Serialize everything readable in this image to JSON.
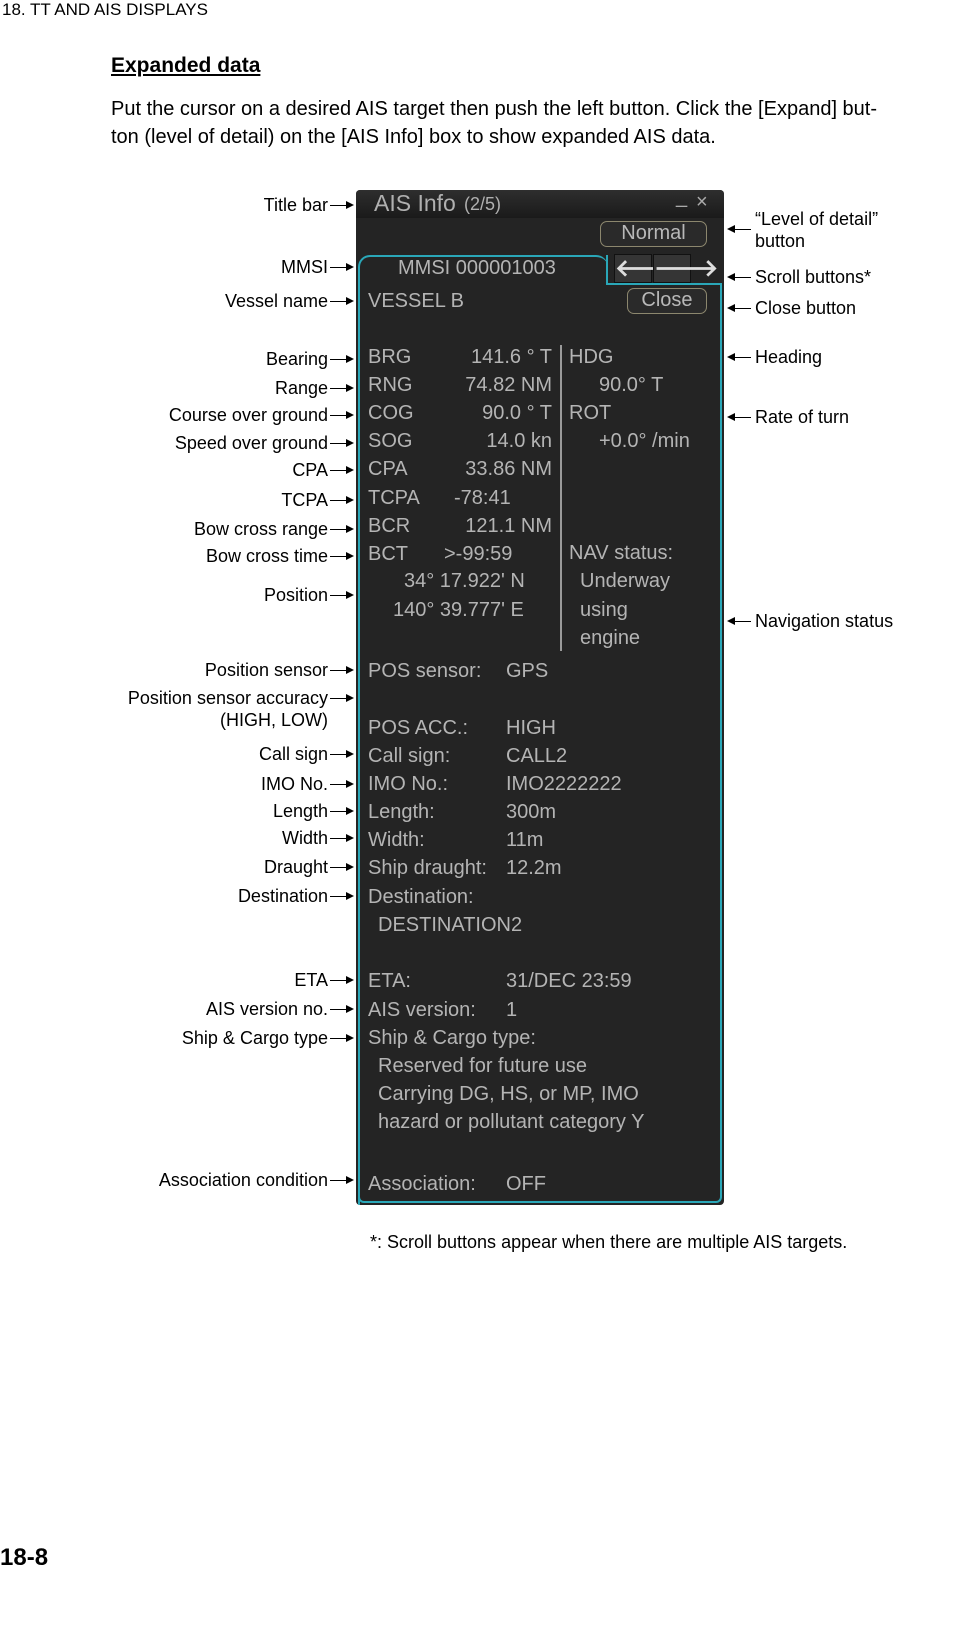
{
  "header": "18.  TT AND AIS DISPLAYS",
  "section_title": "Expanded data",
  "intro": [
    "Put the cursor on a desired AIS target then push the left button. Click the [Expand] but-",
    "ton (level of detail) on the [AIS Info] box to show expanded AIS data."
  ],
  "footnote": "*: Scroll buttons appear when there are multiple AIS targets.",
  "page_number": "18-8",
  "panel": {
    "title": "AIS Info",
    "count": "(2/5)",
    "minimize": "_",
    "close_x": "×",
    "level_button": "Normal",
    "close_button": "Close",
    "scroll_left": "🡐",
    "scroll_right": "🡒",
    "mmsi": "MMSI 000001003",
    "vessel": "VESSEL B",
    "left_rows": [
      [
        "BRG",
        "141.6 ° T"
      ],
      [
        "RNG",
        "74.82 NM"
      ],
      [
        "COG",
        "90.0 ° T"
      ],
      [
        "SOG",
        "14.0 kn"
      ],
      [
        "CPA",
        "33.86 NM"
      ],
      [
        "TCPA",
        "-78:41"
      ],
      [
        "BCR",
        "121.1 NM"
      ],
      [
        "BCT",
        ">-99:59"
      ]
    ],
    "lat": "34° 17.922'  N",
    "lon": "140° 39.777'  E",
    "hdg_label": "HDG",
    "hdg": "90.0° T",
    "rot_label": "ROT",
    "rot": "+0.0° /min",
    "nav_label": "NAV status:",
    "nav_lines": [
      "Underway",
      "using",
      "engine"
    ],
    "details": [
      [
        "POS sensor:",
        "GPS"
      ],
      [
        "POS ACC.:",
        "HIGH"
      ],
      [
        "Call sign:",
        "CALL2"
      ],
      [
        "IMO No.:",
        "IMO2222222"
      ],
      [
        "Length:",
        "300m"
      ],
      [
        "Width:",
        "11m"
      ],
      [
        "Ship draught:",
        "12.2m"
      ],
      [
        "Destination:",
        ""
      ],
      [
        "",
        "DESTINATION2"
      ],
      [
        "ETA:",
        "31/DEC 23:59"
      ],
      [
        "AIS version:",
        "1"
      ],
      [
        "Ship & Cargo type:",
        ""
      ],
      [
        "",
        "Reserved for future use"
      ],
      [
        "",
        "Carrying DG, HS, or MP, IMO"
      ],
      [
        "",
        "hazard or pollutant category Y"
      ],
      [
        "Association:",
        "OFF"
      ]
    ]
  },
  "left_labels": [
    "Title bar",
    "MMSI",
    "Vessel name",
    "Bearing",
    "Range",
    "Course over ground",
    "Speed over ground",
    "CPA",
    "TCPA",
    "Bow cross range",
    "Bow cross time",
    "Position",
    "Position sensor",
    "Position sensor accuracy",
    "(HIGH, LOW)",
    "Call sign",
    "IMO No.",
    "Length",
    "Width",
    "Draught",
    "Destination",
    "ETA",
    "AIS version no.",
    "Ship & Cargo type",
    "Association condition"
  ],
  "right_labels": [
    "“Level of detail”",
    "button",
    "Scroll buttons*",
    "Close button",
    "Heading",
    "Rate of turn",
    "Navigation status"
  ],
  "colors": {
    "panel_bg": "#242424",
    "tab_border": "#2aa7b8",
    "text": "#b4b4b4",
    "button_border": "#8c876e"
  }
}
